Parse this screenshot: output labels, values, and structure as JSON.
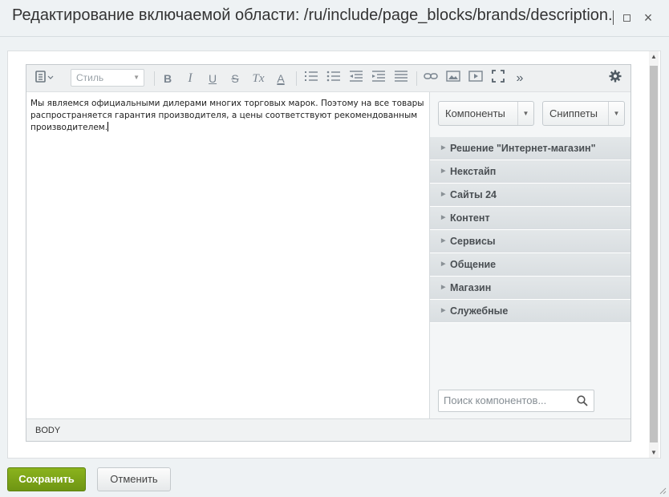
{
  "dialog": {
    "title": "Редактирование включаемой области: /ru/include/page_blocks/brands/description.",
    "close_symbol": "×"
  },
  "toolbar": {
    "style_placeholder": "Стиль",
    "bold": "B",
    "italic": "I",
    "underline": "U",
    "strike": "S",
    "clear_format": "Tx",
    "font_color": "A",
    "more": "»"
  },
  "editor": {
    "content": "Мы являемся официальными дилерами многих торговых марок. Поэтому на все товары распространяется гарантия производителя, а цены соответствуют рекомендованным производителем.",
    "status_path": "BODY"
  },
  "components_panel": {
    "components_button": "Компоненты",
    "snippets_button": "Сниппеты",
    "tree": [
      {
        "label": "Решение \"Интернет-магазин\""
      },
      {
        "label": "Некстайп"
      },
      {
        "label": "Сайты 24"
      },
      {
        "label": "Контент"
      },
      {
        "label": "Сервисы"
      },
      {
        "label": "Общение"
      },
      {
        "label": "Магазин"
      },
      {
        "label": "Служебные"
      }
    ],
    "search_placeholder": "Поиск компонентов..."
  },
  "footer": {
    "save_button": "Сохранить",
    "cancel_button": "Отменить"
  },
  "colors": {
    "save_green": "#7aa318",
    "background": "#eef2f4"
  }
}
